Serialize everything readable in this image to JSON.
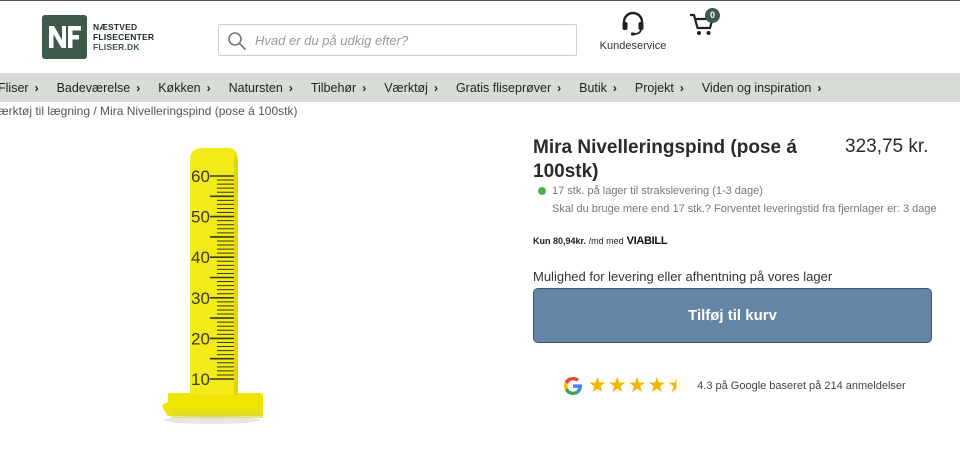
{
  "header": {
    "logo": {
      "mark": "NF",
      "line1": "NÆSTVED",
      "line2": "FLISECENTER",
      "line3": "FLISER.DK"
    },
    "search": {
      "placeholder": "Hvad er du på udkig efter?",
      "icon": "search-icon"
    },
    "service": {
      "label": "Kundeservice",
      "icon": "headset-icon"
    },
    "cart": {
      "count": "0",
      "icon": "cart-icon"
    }
  },
  "nav": {
    "items": [
      {
        "label": "Fliser"
      },
      {
        "label": "Badeværelse"
      },
      {
        "label": "Køkken"
      },
      {
        "label": "Natursten"
      },
      {
        "label": "Tilbehør"
      },
      {
        "label": "Værktøj"
      },
      {
        "label": "Gratis fliseprøver"
      },
      {
        "label": "Butik"
      },
      {
        "label": "Projekt"
      },
      {
        "label": "Viden og inspiration"
      }
    ],
    "chevron": "›"
  },
  "breadcrumb": "ærktøj til lægning / Mira Nivelleringspind (pose á 100stk)",
  "product": {
    "title": "Mira Nivelleringspind (pose á 100stk)",
    "price": "323,75 kr.",
    "stock": "17 stk. på lager til strakslevering (1-3 dage)",
    "stock_note": "Skal du bruge mere end 17 stk.? Forventet leveringstid fra fjernlager er: 3 dage",
    "viabill": {
      "prefix": "Kun",
      "amount": "80,94kr.",
      "suffix": "/md med",
      "brand": "VIABILL"
    },
    "delivery": "Mulighed for levering eller afhentning på vores lager",
    "add_to_cart": "Tilføj til kurv",
    "image": {
      "ruler_labels": [
        "60",
        "50",
        "40",
        "30",
        "20",
        "10"
      ]
    }
  },
  "reviews": {
    "rating": 4.3,
    "stars_full": 4,
    "stars_half": 1,
    "text": "4.3 på Google baseret på 214 anmeldelser"
  },
  "colors": {
    "brand_green": "#3f5a4a",
    "nav_bg": "#d6ddd6",
    "button": "#6485a6",
    "star": "#f4b400",
    "stock_dot": "#4caf50"
  }
}
